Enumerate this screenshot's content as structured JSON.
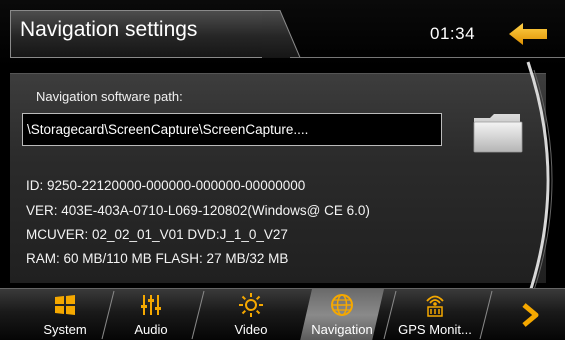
{
  "header": {
    "title": "Navigation settings",
    "clock": "01:34"
  },
  "main": {
    "path_label": "Navigation software path:",
    "path_value": "\\Storagecard\\ScreenCapture\\ScreenCapture....",
    "info": {
      "id": "ID: 9250-22120000-000000-000000-00000000",
      "ver": "VER: 403E-403A-0710-L069-120802(Windows@ CE 6.0)",
      "mcuver": "MCUVER: 02_02_01_V01  DVD:J_1_0_V27",
      "ram_flash": "RAM: 60 MB/110 MB     FLASH: 27 MB/32 MB"
    }
  },
  "tabs": [
    {
      "label": "System",
      "icon": "windows-icon",
      "active": false
    },
    {
      "label": "Audio",
      "icon": "equalizer-icon",
      "active": false
    },
    {
      "label": "Video",
      "icon": "sun-icon",
      "active": false
    },
    {
      "label": "Navigation",
      "icon": "globe-icon",
      "active": true
    },
    {
      "label": "GPS Monit...",
      "icon": "gps-antenna-icon",
      "active": false
    }
  ],
  "colors": {
    "accent_orange": "#f5a800",
    "background": "#000000",
    "panel": "#2e2e2e"
  }
}
